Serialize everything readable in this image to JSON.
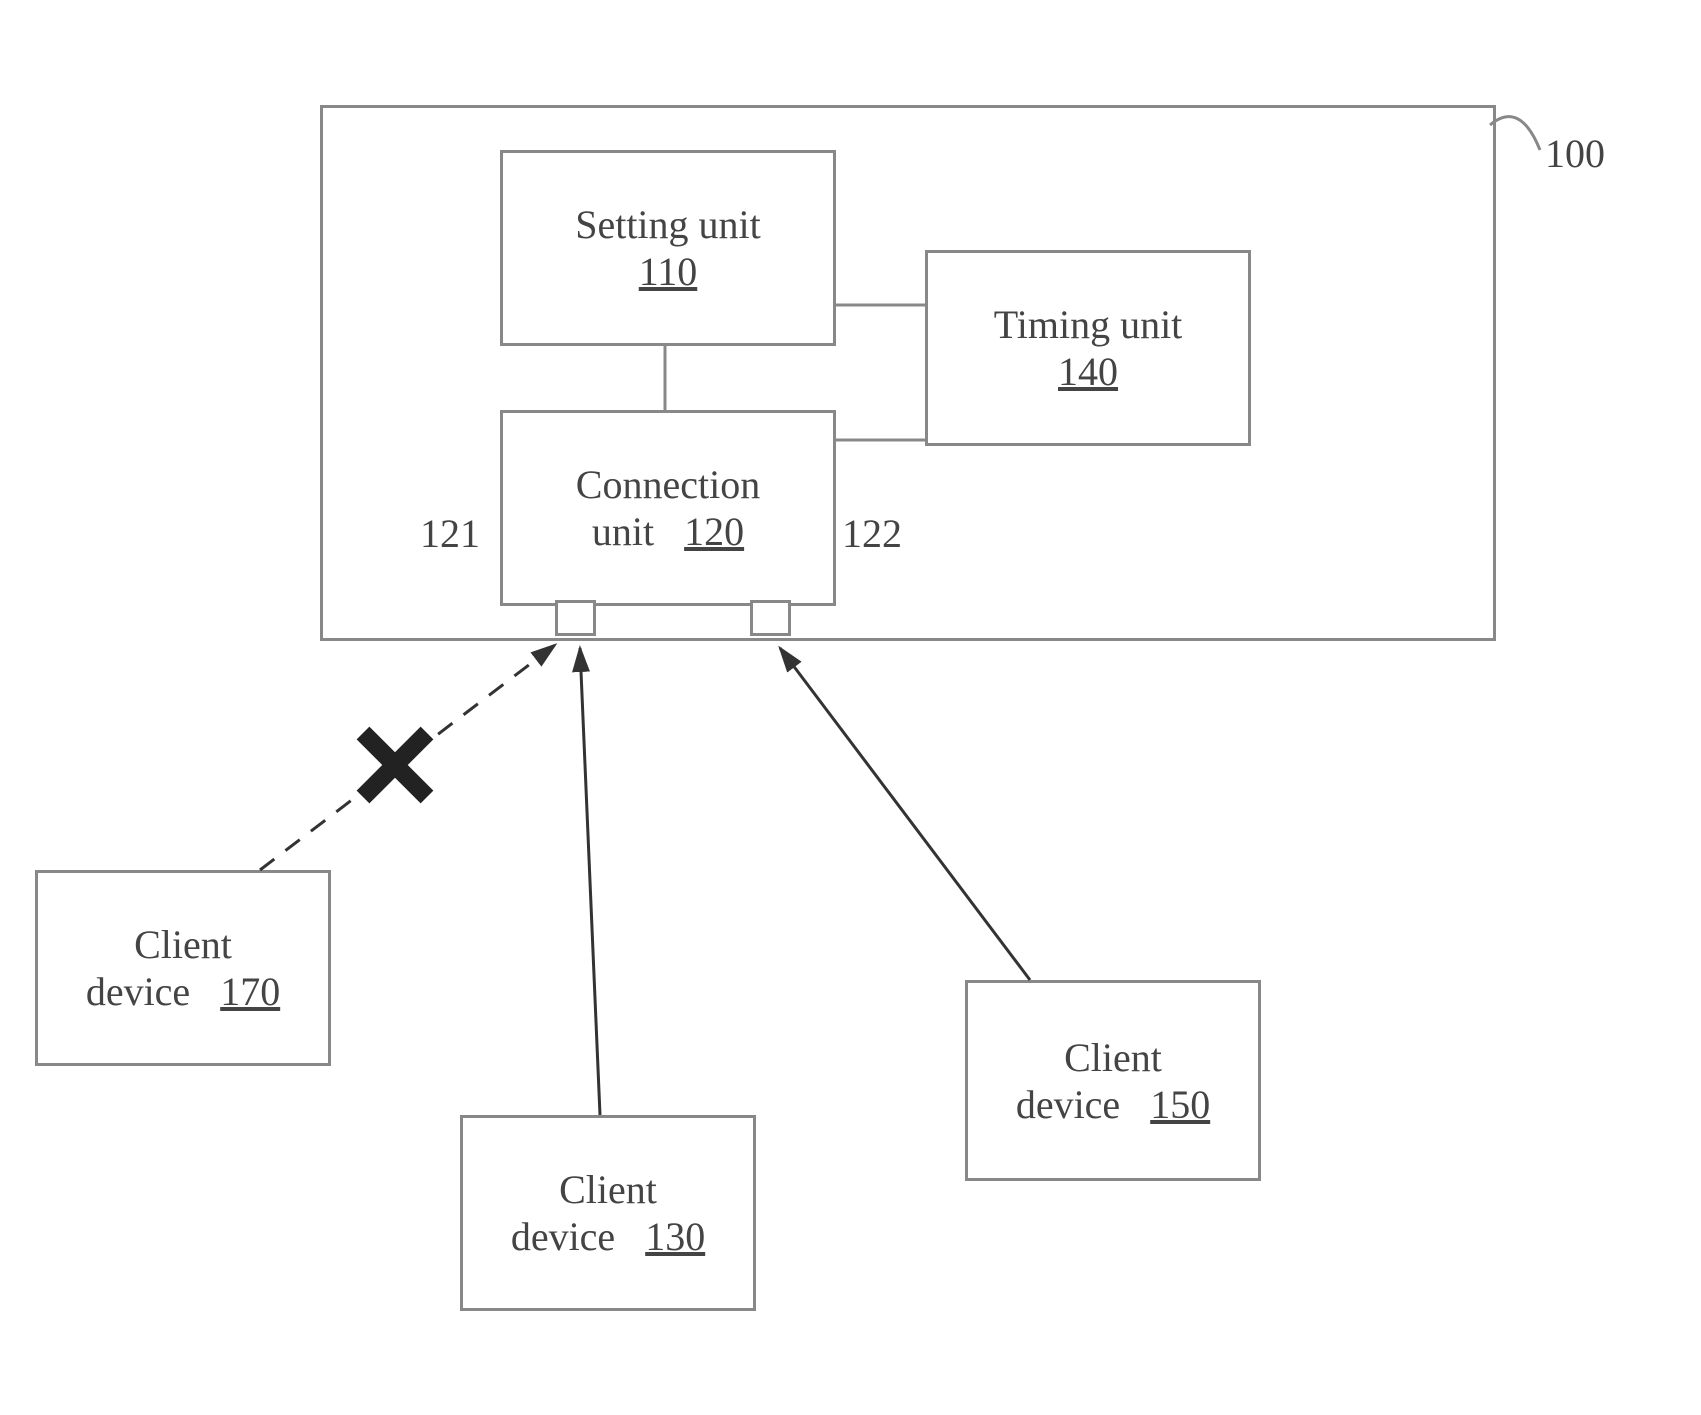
{
  "container": {
    "ref": "100"
  },
  "setting_unit": {
    "label": "Setting unit",
    "ref": "110"
  },
  "timing_unit": {
    "label": "Timing unit",
    "ref": "140"
  },
  "connection_unit": {
    "label_line1": "Connection",
    "label_line2": "unit",
    "ref": "120",
    "port_left_ref": "121",
    "port_right_ref": "122"
  },
  "client_170": {
    "label_line1": "Client",
    "label_line2": "device",
    "ref": "170"
  },
  "client_130": {
    "label_line1": "Client",
    "label_line2": "device",
    "ref": "130"
  },
  "client_150": {
    "label_line1": "Client",
    "label_line2": "device",
    "ref": "150"
  }
}
